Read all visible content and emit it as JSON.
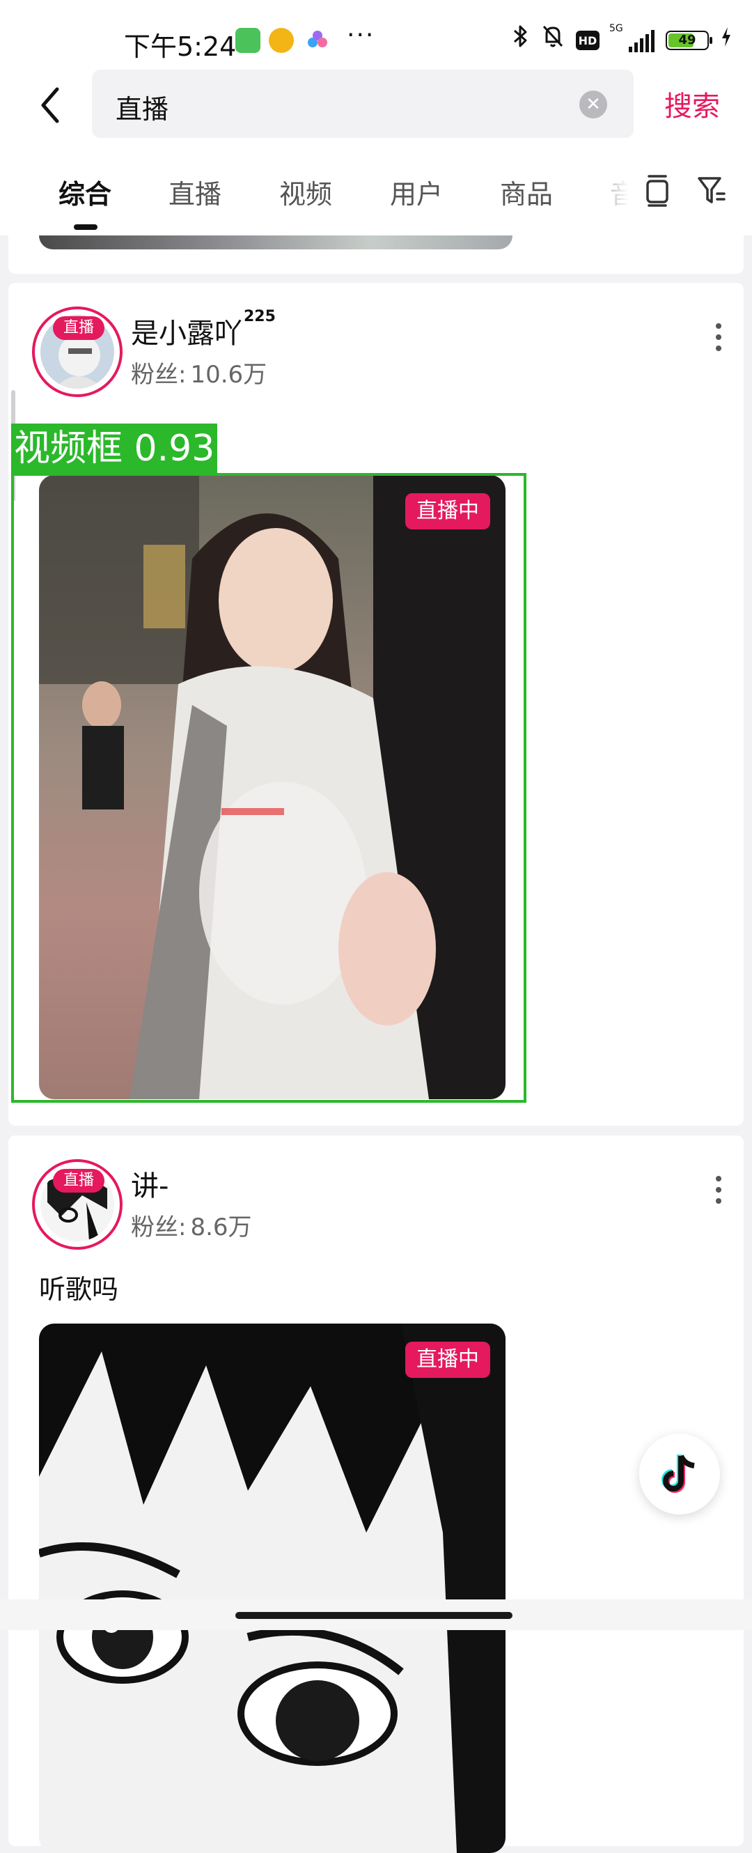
{
  "status_bar": {
    "time": "下午5:24",
    "network": "5G",
    "battery": "49"
  },
  "search": {
    "query": "直播",
    "submit_label": "搜索"
  },
  "tabs": [
    {
      "label": "综合",
      "active": true
    },
    {
      "label": "直播"
    },
    {
      "label": "视频"
    },
    {
      "label": "用户"
    },
    {
      "label": "商品"
    },
    {
      "label": "音"
    }
  ],
  "results": [
    {
      "user_name": "是小露吖",
      "superscript": "225",
      "fans_label": "粉丝:",
      "fans_value": "10.6万",
      "live_badge": "直播",
      "description": "",
      "live_tag": "直播中"
    },
    {
      "user_name": "讲-",
      "fans_label": "粉丝:",
      "fans_value": "8.6万",
      "live_badge": "直播",
      "description": "听歌吗",
      "live_tag": "直播中"
    }
  ],
  "detection": {
    "label": "视频框 0.93",
    "color": "#2bb82b"
  },
  "colors": {
    "accent": "#e5195e",
    "page_bg": "#f2f2f4"
  }
}
